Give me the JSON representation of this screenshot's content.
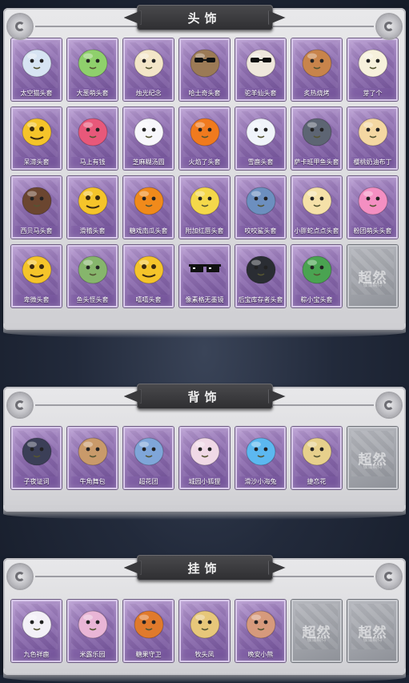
{
  "sections": [
    {
      "title": "头饰",
      "items": [
        {
          "label": "太空猫头套",
          "icon": "blob-cat-head-icon",
          "color": "#d7e4f3"
        },
        {
          "label": "大葱萌头套",
          "icon": "green-onion-head-icon",
          "color": "#8fd06c"
        },
        {
          "label": "烛光纪念",
          "icon": "candle-head-icon",
          "color": "#f3e6c8"
        },
        {
          "label": "哈士奇头套",
          "icon": "husky-sunglasses-head-icon",
          "color": "#9b7a56"
        },
        {
          "label": "驼羊仙头套",
          "icon": "bear-sunglasses-head-icon",
          "color": "#efe7dc"
        },
        {
          "label": "炙热烧烤",
          "icon": "toast-block-head-icon",
          "color": "#c8844b"
        },
        {
          "label": "芽了个",
          "icon": "garlic-head-icon",
          "color": "#f7f1dc"
        },
        {
          "label": "呆滞头套",
          "icon": "dazed-emoji-head-icon",
          "color": "#f5c42a"
        },
        {
          "label": "马上有钱",
          "icon": "pink-horse-head-icon",
          "color": "#e8587a"
        },
        {
          "label": "芝麻糊汤圆",
          "icon": "rice-ball-head-icon",
          "color": "#f7f7fb"
        },
        {
          "label": "火焰了头套",
          "icon": "flame-head-icon",
          "color": "#f07a1e"
        },
        {
          "label": "雪鹿头套",
          "icon": "snowman-antler-head-icon",
          "color": "#f0f4fa"
        },
        {
          "label": "萨卡班甲鱼头套",
          "icon": "fish-head-icon",
          "color": "#5d6573"
        },
        {
          "label": "樱桃奶油布丁",
          "icon": "pudding-head-icon",
          "color": "#f4d7a2"
        },
        {
          "label": "西贝马头套",
          "icon": "horse-mask-head-icon",
          "color": "#6b4630"
        },
        {
          "label": "滑稽头套",
          "icon": "smirk-emoji-head-icon",
          "color": "#f5c42a"
        },
        {
          "label": "糖戏南瓜头套",
          "icon": "pumpkin-head-icon",
          "color": "#f08a1b"
        },
        {
          "label": "附加红唇头套",
          "icon": "pikachu-lips-head-icon",
          "color": "#f4d84a"
        },
        {
          "label": "咬咬鲨头套",
          "icon": "shark-head-icon",
          "color": "#6c8fbf"
        },
        {
          "label": "小胖蛇点点头套",
          "icon": "glasses-bun-head-icon",
          "color": "#f5e1a8"
        },
        {
          "label": "粉团萌头头套",
          "icon": "pink-bear-head-icon",
          "color": "#f48fc2"
        },
        {
          "label": "卑微头套",
          "icon": "sad-emoji-head-icon",
          "color": "#f5c42a"
        },
        {
          "label": "鱼头怪头套",
          "icon": "frog-face-head-icon",
          "color": "#86b56c"
        },
        {
          "label": "嘻嘻头套",
          "icon": "grin-emoji-head-icon",
          "color": "#f5c42a"
        },
        {
          "label": "像素格无墨镜",
          "icon": "pixel-sunglasses-icon",
          "color": "#111111"
        },
        {
          "label": "后宝库存者头套",
          "icon": "helmet-head-icon",
          "color": "#2a2d33"
        },
        {
          "label": "粽小宝头套",
          "icon": "zongzi-head-icon",
          "color": "#4aa351"
        },
        {
          "label": "",
          "icon": "empty-slot-icon",
          "color": "",
          "empty": true
        }
      ]
    },
    {
      "title": "背饰",
      "items": [
        {
          "label": "子夜证词",
          "icon": "dark-wings-back-icon",
          "color": "#3b3f57"
        },
        {
          "label": "牛角舞包",
          "icon": "treasure-backpack-icon",
          "color": "#c99a6a"
        },
        {
          "label": "超花团",
          "icon": "flower-wreath-back-icon",
          "color": "#7fa6d9"
        },
        {
          "label": "城园小狐狸",
          "icon": "fox-back-icon",
          "color": "#f0d9e6"
        },
        {
          "label": "滑沙小海兔",
          "icon": "sea-bunny-back-icon",
          "color": "#5cb8f0"
        },
        {
          "label": "捷恋花",
          "icon": "ornate-wreath-back-icon",
          "color": "#e7d08c"
        },
        {
          "label": "",
          "icon": "empty-slot-icon",
          "color": "",
          "empty": true
        }
      ]
    },
    {
      "title": "挂饰",
      "items": [
        {
          "label": "九色祥鹿",
          "icon": "deer-pendant-icon",
          "color": "#f3f0f7"
        },
        {
          "label": "米露乐园",
          "icon": "bunny-girl-pendant-icon",
          "color": "#e9b5d6"
        },
        {
          "label": "糖果守卫",
          "icon": "pumpkin-guard-pendant-icon",
          "color": "#e07a2c"
        },
        {
          "label": "牧头凤",
          "icon": "phoenix-girl-pendant-icon",
          "color": "#e7c77a"
        },
        {
          "label": "晚安小熊",
          "icon": "bear-pendant-icon",
          "color": "#d69a7c"
        },
        {
          "label": "",
          "icon": "empty-slot-icon",
          "color": "",
          "empty": true
        },
        {
          "label": "",
          "icon": "empty-slot-icon",
          "color": "",
          "empty": true
        }
      ]
    }
  ],
  "empty_slot": {
    "mark": "超然",
    "sub": "敬请期待"
  }
}
